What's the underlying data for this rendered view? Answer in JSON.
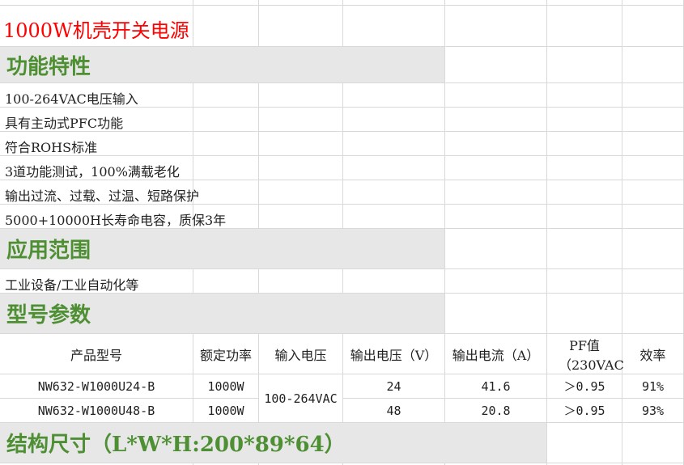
{
  "title": "1000W机壳开关电源",
  "sections": {
    "features": "功能特性",
    "applications": "应用范围",
    "models": "型号参数",
    "dimensions": "结构尺寸（L*W*H:200*89*64）"
  },
  "features": [
    "100-264VAC电压输入",
    "具有主动式PFC功能",
    "符合ROHS标准",
    "3道功能测试，100%满载老化",
    "输出过流、过载、过温、短路保护",
    "5000+10000H长寿命电容，质保3年"
  ],
  "applications": [
    "工业设备/工业自动化等"
  ],
  "table": {
    "headers": [
      "产品型号",
      "额定功率",
      "输入电压",
      "输出电压（V）",
      "输出电流（A）",
      "PF值",
      "（230VAC",
      "效率"
    ],
    "input_voltage": "100-264VAC",
    "rows": [
      {
        "model": "NW632-W1000U24-B",
        "power": "1000W",
        "vout": "24",
        "iout": "41.6",
        "pf": "＞0.95",
        "eff": "91%"
      },
      {
        "model": "NW632-W1000U48-B",
        "power": "1000W",
        "vout": "48",
        "iout": "20.8",
        "pf": "＞0.95",
        "eff": "93%"
      }
    ]
  }
}
